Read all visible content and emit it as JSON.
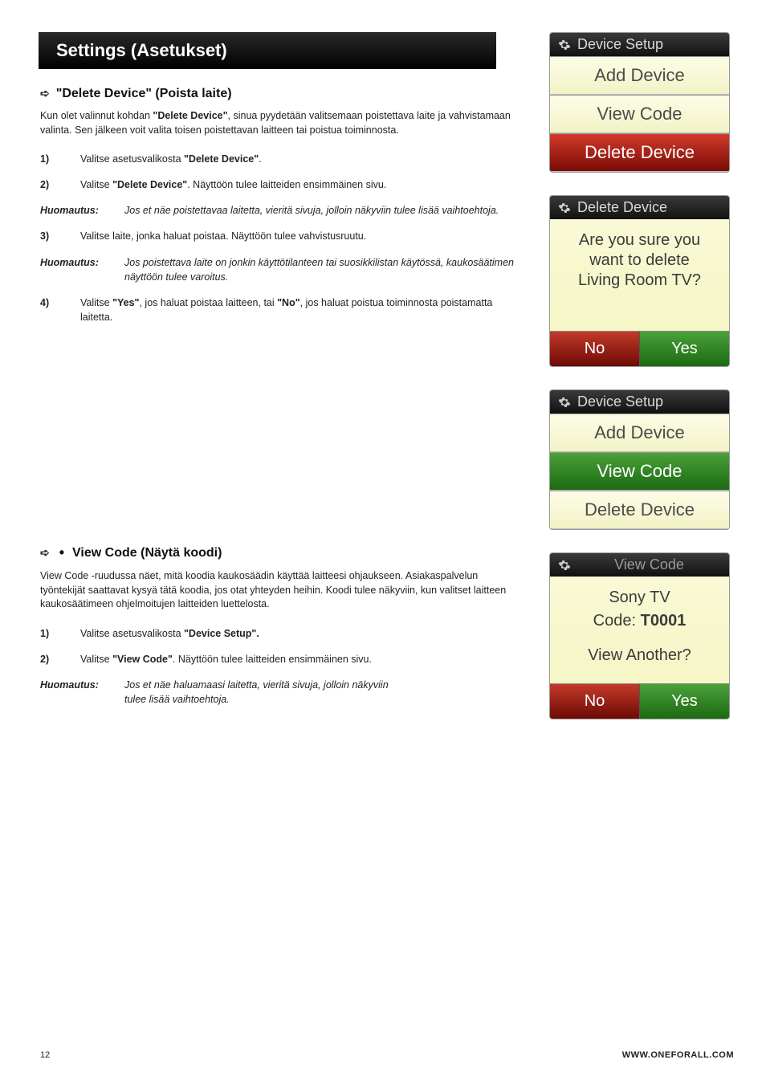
{
  "page_header": "Settings (Asetukset)",
  "section1": {
    "title": "\"Delete Device\" (Poista laite)",
    "intro_pre": "Kun olet valinnut kohdan ",
    "intro_bold": "\"Delete Device\"",
    "intro_post": ", sinua pyydetään valitsemaan poistettava laite ja vahvistamaan valinta. Sen jälkeen voit valita toisen poistettavan laitteen tai poistua toiminnosta.",
    "steps": [
      {
        "n": "1)",
        "pre": "Valitse asetusvalikosta ",
        "bold": "\"Delete Device\"",
        "post": "."
      },
      {
        "n": "2)",
        "pre": "Valitse ",
        "bold": "\"Delete Device\"",
        "post": ". Näyttöön tulee laitteiden ensimmäinen sivu."
      }
    ],
    "note1_label": "Huomautus:",
    "note1_text": "Jos et näe poistettavaa laitetta, vieritä sivuja, jolloin näkyviin tulee lisää vaihtoehtoja.",
    "step3": {
      "n": "3)",
      "text": "Valitse laite, jonka haluat poistaa. Näyttöön tulee vahvistusruutu."
    },
    "note2_label": "Huomautus:",
    "note2_text": "Jos poistettava laite on jonkin käyttötilanteen tai suosikkilistan käytössä, kaukosäätimen näyttöön tulee varoitus.",
    "step4": {
      "n": "4)",
      "pre": "Valitse ",
      "bold1": "\"Yes\"",
      "mid": ", jos haluat poistaa laitteen, tai ",
      "bold2": "\"No\"",
      "post": ", jos haluat poistua toiminnosta poistamatta laitetta."
    }
  },
  "section2": {
    "title": "View Code (Näytä koodi)",
    "intro": "View Code -ruudussa näet, mitä koodia kaukosäädin käyttää laitteesi ohjaukseen. Asiakaspalvelun työntekijät saattavat kysyä tätä koodia, jos otat yhteyden heihin.  Koodi tulee näkyviin, kun valitset laitteen kaukosäätimeen ohjelmoitujen laitteiden luettelosta.",
    "steps": [
      {
        "n": "1)",
        "pre": "Valitse asetusvalikosta ",
        "bold": "\"Device Setup\"."
      },
      {
        "n": "2)",
        "pre": "Valitse ",
        "bold": "\"View Code\"",
        "post": ". Näyttöön tulee laitteiden ensimmäinen sivu."
      }
    ],
    "note_label": "Huomautus:",
    "note_text": "Jos et näe haluamaasi laitetta, vieritä sivuja, jolloin näkyviin tulee lisää vaihtoehtoja."
  },
  "sim1": {
    "header": "Device Setup",
    "items": [
      "Add Device",
      "View Code",
      "Delete Device"
    ]
  },
  "sim2": {
    "header": "Delete Device",
    "body_l1": "Are you sure you",
    "body_l2": "want to delete",
    "body_l3": "Living Room TV?",
    "no": "No",
    "yes": "Yes"
  },
  "sim3": {
    "header": "Device Setup",
    "items": [
      "Add Device",
      "View Code",
      "Delete Device"
    ]
  },
  "sim4": {
    "header": "View Code",
    "device": "Sony TV",
    "code_label": "Code:",
    "code_value": "T0001",
    "view_another": "View Another?",
    "no": "No",
    "yes": "Yes"
  },
  "footer": {
    "page_no": "12",
    "url": "WWW.ONEFORALL.COM"
  }
}
